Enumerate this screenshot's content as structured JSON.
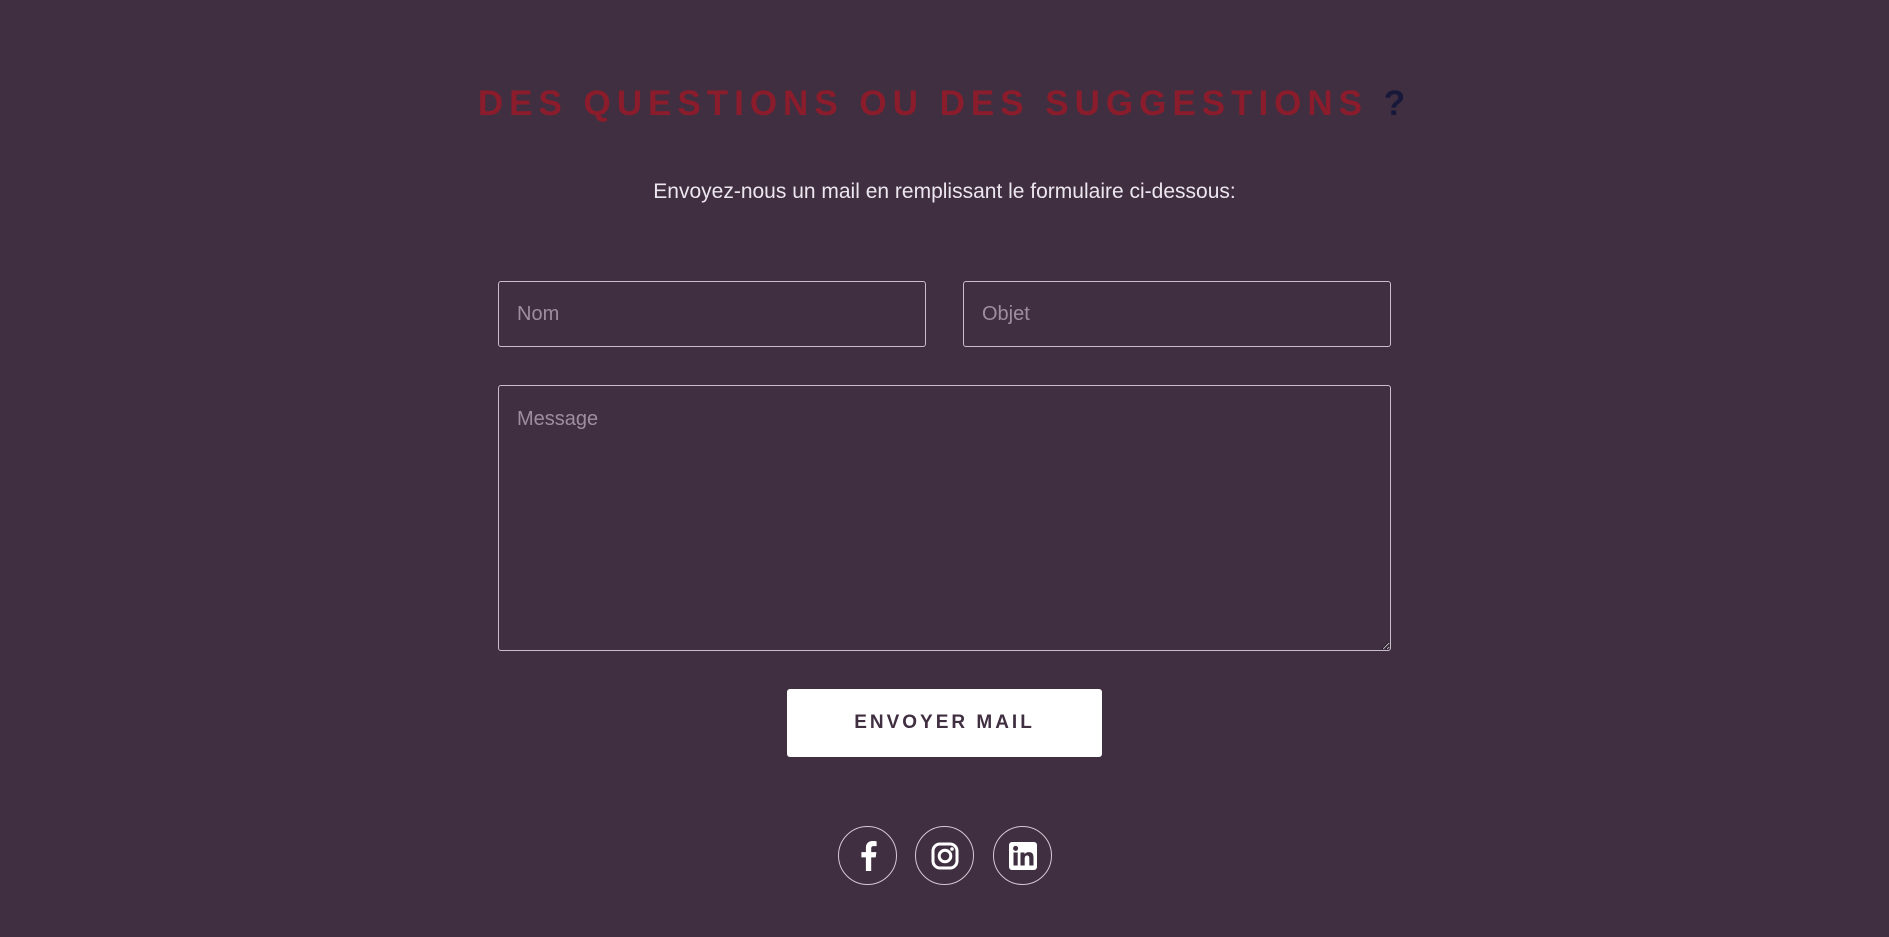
{
  "contact": {
    "heading_main": "DES QUESTIONS OU DES SUGGESTIONS",
    "heading_mark": "?",
    "subtitle": "Envoyez-nous un mail en remplissant le formulaire ci-dessous:",
    "form": {
      "name": {
        "placeholder": "Nom",
        "value": ""
      },
      "subject": {
        "placeholder": "Objet",
        "value": ""
      },
      "message": {
        "placeholder": "Message",
        "value": ""
      },
      "submit_label": "ENVOYER MAIL"
    },
    "socials": [
      {
        "icon": "facebook-icon"
      },
      {
        "icon": "instagram-icon"
      },
      {
        "icon": "linkedin-icon"
      }
    ]
  },
  "colors": {
    "background": "#402f41",
    "heading_accent": "#8a1c2c",
    "question_mark": "#17183a",
    "text": "#ece6ee",
    "field_border": "#c9bdc9",
    "button_bg": "#ffffff",
    "button_text": "#402f41"
  }
}
